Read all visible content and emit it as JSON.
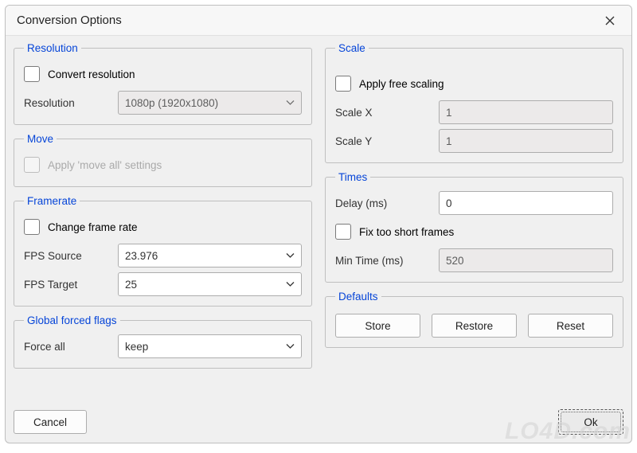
{
  "title": "Conversion Options",
  "resolution": {
    "legend": "Resolution",
    "convert_label": "Convert resolution",
    "res_label": "Resolution",
    "res_value": "1080p (1920x1080)"
  },
  "move": {
    "legend": "Move",
    "apply_label": "Apply 'move all' settings"
  },
  "framerate": {
    "legend": "Framerate",
    "change_label": "Change frame rate",
    "src_label": "FPS Source",
    "src_value": "23.976",
    "tgt_label": "FPS Target",
    "tgt_value": "25"
  },
  "global": {
    "legend": "Global forced flags",
    "force_label": "Force all",
    "force_value": "keep"
  },
  "scale": {
    "legend": "Scale",
    "apply_label": "Apply free scaling",
    "x_label": "Scale X",
    "x_value": "1",
    "y_label": "Scale Y",
    "y_value": "1"
  },
  "times": {
    "legend": "Times",
    "delay_label": "Delay (ms)",
    "delay_value": "0",
    "fix_label": "Fix too short frames",
    "min_label": "Min Time (ms)",
    "min_value": "520"
  },
  "defaults": {
    "legend": "Defaults",
    "store": "Store",
    "restore": "Restore",
    "reset": "Reset"
  },
  "buttons": {
    "cancel": "Cancel",
    "ok": "Ok"
  },
  "watermark": "LO4D.com"
}
